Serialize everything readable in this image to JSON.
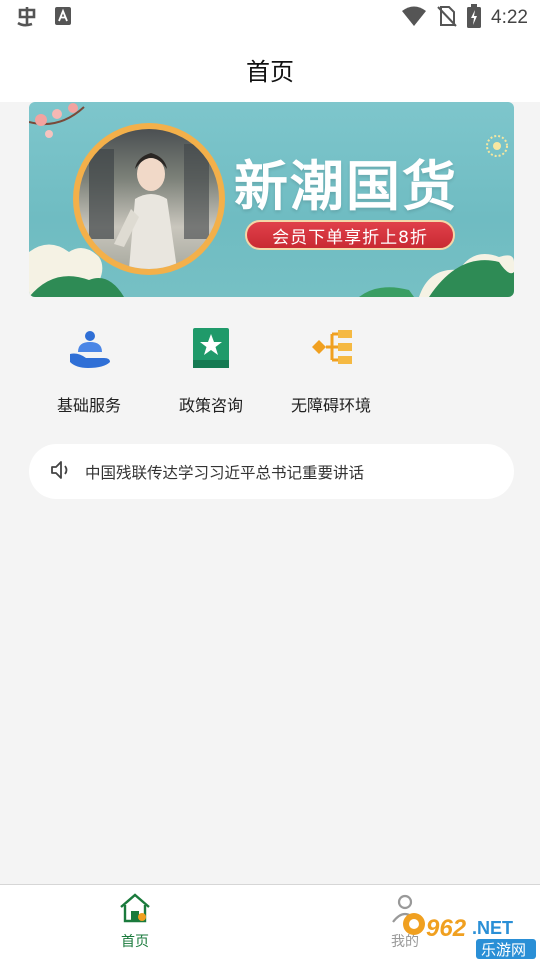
{
  "status_bar": {
    "time": "4:22",
    "icons": [
      "bug-icon",
      "font-a-icon",
      "wifi-icon",
      "no-sim-icon",
      "battery-charging-icon"
    ]
  },
  "header": {
    "title": "首页"
  },
  "banner": {
    "title": "新潮国货",
    "subtitle": "会员下单享折上8折"
  },
  "menu": {
    "items": [
      {
        "label": "基础服务",
        "icon": "service-hand-icon"
      },
      {
        "label": "政策咨询",
        "icon": "policy-star-icon"
      },
      {
        "label": "无障碍环境",
        "icon": "accessibility-tree-icon"
      }
    ]
  },
  "notice": {
    "icon": "speaker-icon",
    "text": "中国残联传达学习习近平总书记重要讲话"
  },
  "tabbar": {
    "tabs": [
      {
        "label": "首页",
        "icon": "home-icon",
        "active": true
      },
      {
        "label": "我的",
        "icon": "profile-icon",
        "active": false
      }
    ],
    "active_color": "#1a7a3c"
  },
  "watermark": {
    "text": "962.NET",
    "sub": "乐游网"
  },
  "colors": {
    "banner_bg": "#74c1c6",
    "menu_blue": "#2f6fd6",
    "menu_green": "#1f9a6a",
    "menu_orange": "#f0a020"
  }
}
